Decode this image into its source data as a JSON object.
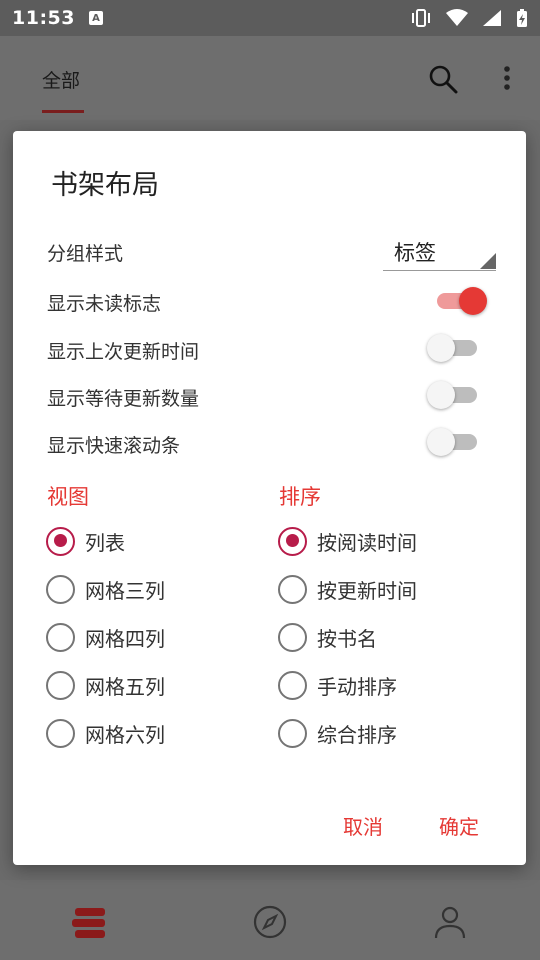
{
  "status_bar": {
    "time": "11:53",
    "notification_icon": "A"
  },
  "app_bar": {
    "tab_all": "全部"
  },
  "dialog": {
    "title": "书架布局",
    "group_style": {
      "label": "分组样式",
      "value": "标签"
    },
    "switches": [
      {
        "label": "显示未读标志",
        "on": true
      },
      {
        "label": "显示上次更新时间",
        "on": false
      },
      {
        "label": "显示等待更新数量",
        "on": false
      },
      {
        "label": "显示快速滚动条",
        "on": false
      }
    ],
    "view": {
      "header": "视图",
      "options": [
        "列表",
        "网格三列",
        "网格四列",
        "网格五列",
        "网格六列"
      ],
      "selected": 0
    },
    "sort": {
      "header": "排序",
      "options": [
        "按阅读时间",
        "按更新时间",
        "按书名",
        "手动排序",
        "综合排序"
      ],
      "selected": 0
    },
    "cancel_label": "取消",
    "ok_label": "确定"
  },
  "colors": {
    "accent": "#e53935",
    "radio_checked": "#b71c4a",
    "switch_track_on": "#ef9a9a"
  },
  "icons": {
    "search": "search-icon",
    "more": "more-vert-icon",
    "bookshelf": "bookshelf-icon",
    "explore": "compass-icon",
    "profile": "person-icon"
  }
}
